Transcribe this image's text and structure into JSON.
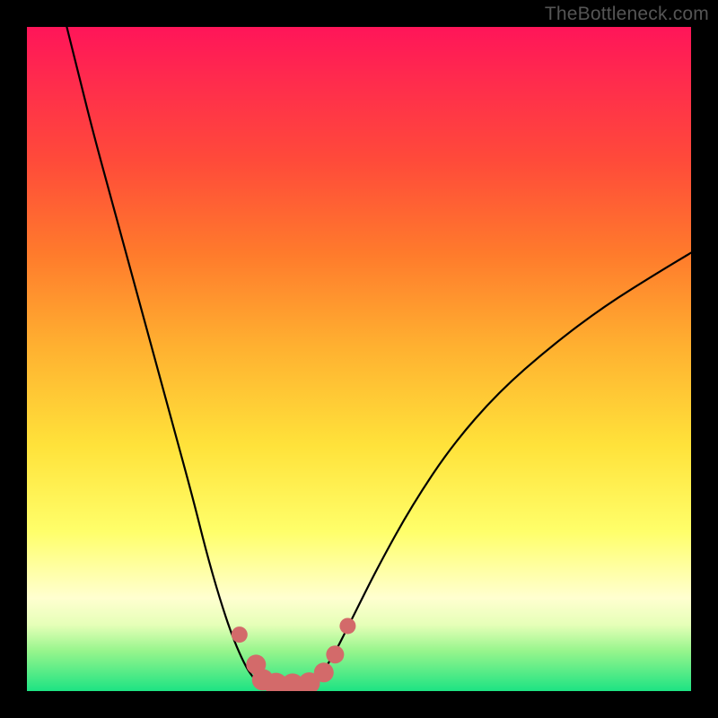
{
  "watermark": "TheBottleneck.com",
  "colors": {
    "frame_bg": "#000000",
    "curve_stroke": "#000000",
    "marker_fill": "#d36a6a",
    "marker_stroke": "#c45a5a",
    "gradient_top": "#ff1559",
    "gradient_bottom": "#1de383"
  },
  "chart_data": {
    "type": "line",
    "title": "",
    "xlabel": "",
    "ylabel": "",
    "xlim": [
      0,
      1
    ],
    "ylim": [
      0,
      1
    ],
    "series": [
      {
        "name": "left-curve",
        "x": [
          0.06,
          0.08,
          0.1,
          0.13,
          0.16,
          0.19,
          0.22,
          0.25,
          0.27,
          0.29,
          0.31,
          0.33,
          0.345
        ],
        "y": [
          1.0,
          0.92,
          0.84,
          0.73,
          0.62,
          0.51,
          0.4,
          0.29,
          0.21,
          0.14,
          0.08,
          0.035,
          0.015
        ]
      },
      {
        "name": "valley-floor",
        "x": [
          0.345,
          0.36,
          0.38,
          0.4,
          0.42,
          0.435
        ],
        "y": [
          0.015,
          0.01,
          0.008,
          0.008,
          0.01,
          0.015
        ]
      },
      {
        "name": "right-curve",
        "x": [
          0.435,
          0.46,
          0.49,
          0.53,
          0.58,
          0.64,
          0.71,
          0.79,
          0.87,
          0.95,
          1.0
        ],
        "y": [
          0.015,
          0.05,
          0.11,
          0.19,
          0.28,
          0.37,
          0.45,
          0.52,
          0.58,
          0.63,
          0.66
        ]
      }
    ],
    "markers": {
      "name": "highlight-points",
      "points": [
        {
          "x": 0.32,
          "y": 0.085,
          "r": 9
        },
        {
          "x": 0.345,
          "y": 0.04,
          "r": 11
        },
        {
          "x": 0.355,
          "y": 0.017,
          "r": 12
        },
        {
          "x": 0.375,
          "y": 0.01,
          "r": 13
        },
        {
          "x": 0.4,
          "y": 0.009,
          "r": 13
        },
        {
          "x": 0.425,
          "y": 0.012,
          "r": 12
        },
        {
          "x": 0.447,
          "y": 0.028,
          "r": 11
        },
        {
          "x": 0.464,
          "y": 0.055,
          "r": 10
        },
        {
          "x": 0.483,
          "y": 0.098,
          "r": 9
        }
      ]
    }
  }
}
